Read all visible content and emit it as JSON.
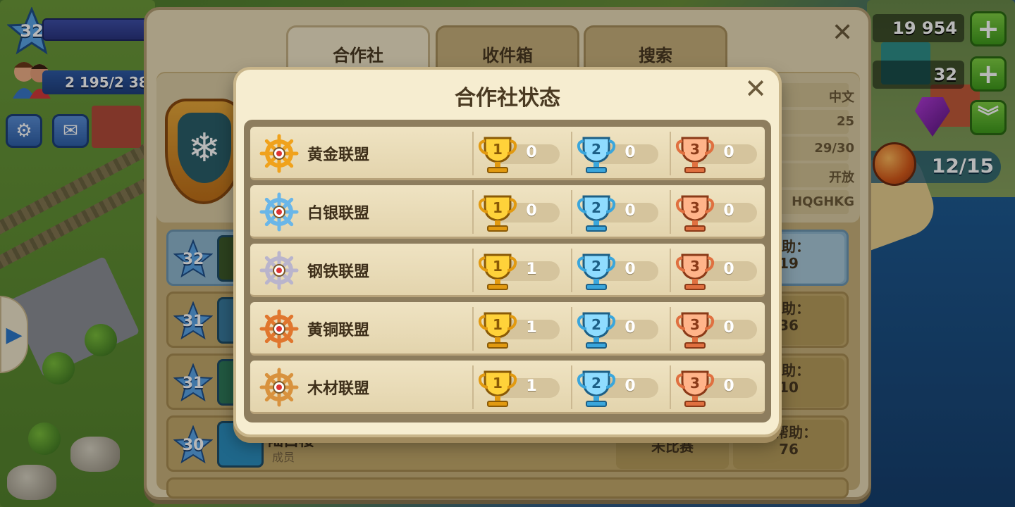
{
  "hud": {
    "level": "32",
    "population": "2 195/2 38",
    "coins": "19 954",
    "gems_or_level2": "32",
    "fruit": "12/15",
    "settings_icon": "gear-icon",
    "mail_icon": "mail-icon",
    "plus_label": "+"
  },
  "coop_panel": {
    "tabs": [
      {
        "label": "合作社"
      },
      {
        "label": "收件箱"
      },
      {
        "label": "搜索"
      }
    ],
    "info": [
      "中文",
      "25",
      "29/30",
      "开放",
      "HQGHKG"
    ],
    "members": [
      {
        "level": "32",
        "help": "帮助：\n19",
        "help_l1": "帮助：",
        "help_l2": "19"
      },
      {
        "level": "31",
        "help_l1": "帮助：",
        "help_l2": "36"
      },
      {
        "level": "31",
        "help_l1": "帮助：",
        "help_l2": "10"
      },
      {
        "level": "30",
        "name": "陆白楼",
        "role": "成员",
        "status": "未比赛",
        "help_l1": "已帮助：",
        "help_l2": "76"
      }
    ]
  },
  "modal": {
    "title": "合作社状态",
    "close_icon": "close-icon",
    "leagues": [
      {
        "name": "黄金联盟",
        "gold": "0",
        "silver": "0",
        "bronze": "0",
        "color": "#f0a21c"
      },
      {
        "name": "白银联盟",
        "gold": "0",
        "silver": "0",
        "bronze": "0",
        "color": "#6ab6e8"
      },
      {
        "name": "钢铁联盟",
        "gold": "1",
        "silver": "0",
        "bronze": "0",
        "color": "#b9b4cc"
      },
      {
        "name": "黄铜联盟",
        "gold": "1",
        "silver": "0",
        "bronze": "0",
        "color": "#e0762e"
      },
      {
        "name": "木材联盟",
        "gold": "1",
        "silver": "0",
        "bronze": "0",
        "color": "#d8923e"
      }
    ],
    "cup_labels": {
      "gold": "1",
      "silver": "2",
      "bronze": "3"
    }
  }
}
